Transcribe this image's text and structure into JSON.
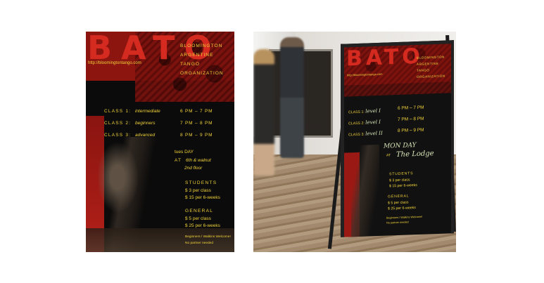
{
  "poster": {
    "title": "BATO",
    "url": "http://bloomingtontango.com",
    "org": [
      "BLOOMINGTON",
      "ARGENTINE",
      "TANGO",
      "ORGANIZATION"
    ],
    "classes": [
      {
        "label": "CLASS 1:",
        "level": "intermediate",
        "time": "6 PM  –  7 PM"
      },
      {
        "label": "CLASS 2:",
        "level": "beginners",
        "time": "7 PM  –  8 PM"
      },
      {
        "label": "CLASS 3:",
        "level": "advanced",
        "time": "8 PM  –  9 PM"
      }
    ],
    "day": "tues DAY",
    "at_label": "AT",
    "location_line1": "6th & walnut",
    "location_line2": "2nd floor",
    "students_heading": "STUDENTS",
    "students_prices": [
      "$ 3  per class",
      "$ 15 per 6-weeks"
    ],
    "general_heading": "GENERAL",
    "general_prices": [
      "$ 5  per class",
      "$ 25 per 6-weeks"
    ],
    "footer_line1": "Beginners / Walkins Welcome!",
    "footer_line2": "No partner needed"
  },
  "sign": {
    "title": "BATO",
    "url": "http://bloomingtontango.com",
    "org": [
      "BLOOMINGTON",
      "ARGENTINE",
      "TANGO",
      "ORGANIZATION"
    ],
    "classes": [
      {
        "label": "CLASS 1:",
        "level": "level I",
        "time": "6 PM  –  7 PM"
      },
      {
        "label": "CLASS 2:",
        "level": "level I",
        "time": "7 PM  –  8 PM"
      },
      {
        "label": "CLASS 3:",
        "level": "level II",
        "time": "8 PM  –  9 PM"
      }
    ],
    "day": "MON DAY",
    "at_label": "AT",
    "location": "The Lodge",
    "students_heading": "STUDENTS",
    "students_prices": [
      "$ 3  per class",
      "$ 15 per 6-weeks"
    ],
    "general_heading": "GENERAL",
    "general_prices": [
      "$ 5  per class",
      "$ 25 per 6-weeks"
    ],
    "footer_line1": "Beginners / Walkins Welcome!",
    "footer_line2": "No partner needed"
  },
  "colors": {
    "accent_red": "#d42a20",
    "text_yellow": "#f0d23a",
    "chalk": "#d9e6b8"
  }
}
